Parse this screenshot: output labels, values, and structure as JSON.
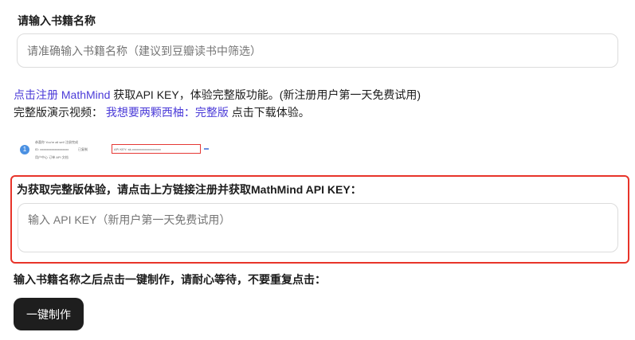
{
  "book": {
    "label": "请输入书籍名称",
    "placeholder": "请准确输入书籍名称（建议到豆瓣读书中筛选）"
  },
  "register_line": {
    "link": "点击注册 MathMind",
    "text": " 获取API KEY，体验完整版功能。(新注册用户第一天免费试用)"
  },
  "video_line": {
    "prefix": "完整版演示视频：",
    "link1": "我想要两颗西柚",
    "sep": "：",
    "link2": "完整版",
    "suffix": " 点击下载体验。"
  },
  "thumbnail": {
    "step": "1",
    "line1": "恭喜你 You're all set! 注册完成",
    "line2a": "ID: xxxxxxxxxxxxxxxxxx",
    "line2b": "已复制",
    "line2c": "API KEY: sk-xxxxxxxxxxxxxxxxxx",
    "line3": "用户中心  订单  API 文档"
  },
  "api": {
    "label": "为获取完整版体验，请点击上方链接注册并获取MathMind API KEY：",
    "placeholder": "输入 API KEY（新用户第一天免费试用）"
  },
  "make": {
    "label": "输入书籍名称之后点击一键制作，请耐心等待，不要重复点击：",
    "button": "一键制作"
  },
  "colors": {
    "accent_link": "#4b3bd8",
    "highlight_border": "#e8342a",
    "button_bg": "#1e1e1e"
  }
}
